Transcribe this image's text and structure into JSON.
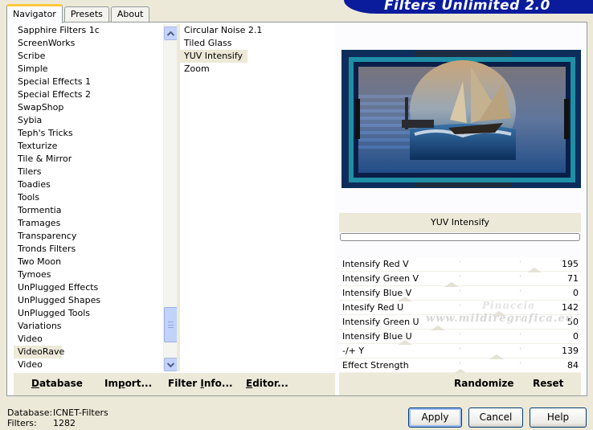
{
  "banner": {
    "title": "Filters Unlimited 2.0"
  },
  "tabs": [
    {
      "label": "Navigator",
      "active": true
    },
    {
      "label": "Presets",
      "active": false
    },
    {
      "label": "About",
      "active": false
    }
  ],
  "categories": [
    "Sapphire Filters 1c",
    "ScreenWorks",
    "Scribe",
    "Simple",
    "Special Effects 1",
    "Special Effects 2",
    "SwapShop",
    "Sybia",
    "Teph's Tricks",
    "Texturize",
    "Tile & Mirror",
    "Tilers",
    "Toadies",
    "Tools",
    "Tormentia",
    "Tramages",
    "Transparency",
    "Tronds Filters",
    "Two Moon",
    "Tymoes",
    "UnPlugged Effects",
    "UnPlugged Shapes",
    "UnPlugged Tools",
    "Variations",
    "Video",
    "VideoRave",
    "Video"
  ],
  "selected_category_index": 25,
  "filters": [
    "Circular Noise 2.1",
    "Tiled Glass",
    "YUV Intensify",
    "Zoom"
  ],
  "selected_filter_index": 2,
  "toolbar": {
    "database": {
      "pre": "",
      "u": "D",
      "post": "atabase"
    },
    "import": {
      "pre": "Im",
      "u": "p",
      "post": "ort..."
    },
    "filter_info": {
      "pre": "Filter ",
      "u": "I",
      "post": "nfo..."
    },
    "editor": {
      "pre": "",
      "u": "E",
      "post": "ditor..."
    }
  },
  "filter_name": "YUV Intensify",
  "parameters": [
    {
      "label": "Intensify Red V",
      "value": 195,
      "max": 255
    },
    {
      "label": "Intensify Green V",
      "value": 71,
      "max": 255
    },
    {
      "label": "Intensify Blue V",
      "value": 0,
      "max": 255
    },
    {
      "label": "Intesify Red U",
      "value": 142,
      "max": 255
    },
    {
      "label": "Intensify Green U",
      "value": 50,
      "max": 255
    },
    {
      "label": "Intensify Blue U",
      "value": 0,
      "max": 255
    },
    {
      "label": "-/+ Y",
      "value": 139,
      "max": 255
    },
    {
      "label": "Effect Strength",
      "value": 84,
      "max": 255
    }
  ],
  "right_toolbar": {
    "randomize": "Randomize",
    "reset": "Reset"
  },
  "watermark": {
    "line1": "Pinuccia",
    "line2": "www.mildiregrafica.eu"
  },
  "footer": {
    "database_label": "Database:",
    "database_value": "ICNET-Filters",
    "filters_label": "Filters:",
    "filters_value": "1282"
  },
  "buttons": {
    "apply": "Apply",
    "cancel": "Cancel",
    "help": "Help"
  },
  "colors": {
    "banner": "#0a1c9c",
    "tab_highlight": "#ffc83c",
    "selection": "#ece9d8"
  }
}
